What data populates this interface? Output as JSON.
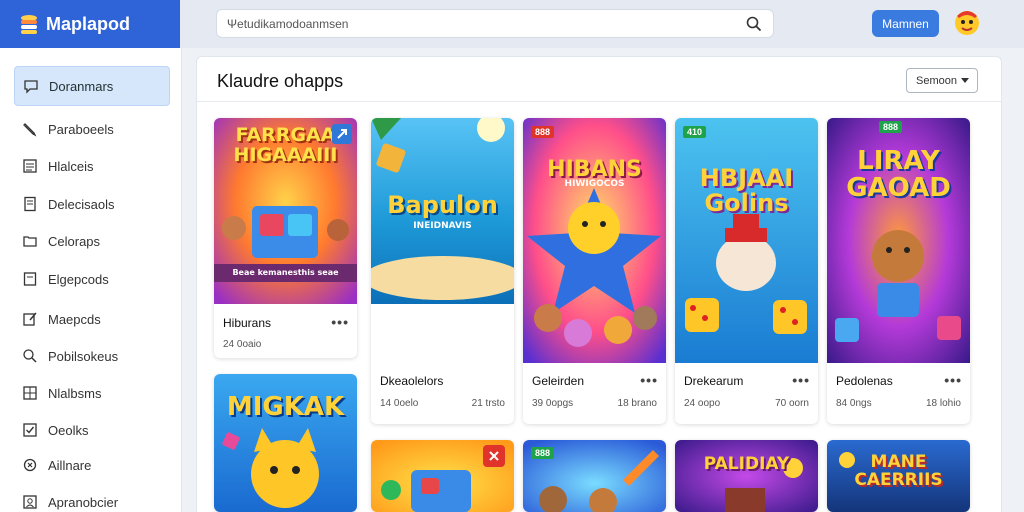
{
  "app": {
    "name": "Maplapod"
  },
  "search": {
    "placeholder": "Ψetudikamodoanmsen"
  },
  "top_button": {
    "label": "Mamnen"
  },
  "sidebar": {
    "items": [
      {
        "label": "Doranmars",
        "icon": "chat-icon"
      },
      {
        "label": "Paraboeels",
        "icon": "pencil-icon"
      },
      {
        "label": "Hlalceis",
        "icon": "list-icon"
      },
      {
        "label": "Delecisaols",
        "icon": "document-icon"
      },
      {
        "label": "Celoraps",
        "icon": "folder-icon"
      },
      {
        "label": "Elgepcods",
        "icon": "page-icon"
      },
      {
        "label": "Maepcds",
        "icon": "edit-icon"
      },
      {
        "label": "Pobilsokeus",
        "icon": "search-icon"
      },
      {
        "label": "Nlalbsms",
        "icon": "grid-icon"
      },
      {
        "label": "Oeolks",
        "icon": "checkbox-icon"
      },
      {
        "label": "Aillnare",
        "icon": "settings-icon"
      },
      {
        "label": "Apranobcier",
        "icon": "user-icon"
      }
    ]
  },
  "panel": {
    "title": "Klaudre ohapps",
    "sort_label": "Semoon"
  },
  "cards": [
    {
      "art_title": "FARRGAA\nHIGAAAIII",
      "art_sub": "Beae kemanesthis seae",
      "name": "Hiburans",
      "meta_left": "24 0oaio",
      "meta_right": "",
      "badge": "",
      "badge_color": ""
    },
    {
      "art_title": "Bapulon",
      "art_sub": "INEIDNAVIS",
      "name": "Dkeaolelors",
      "meta_left": "14 0oelo",
      "meta_right": "21 trsto",
      "badge": "",
      "badge_color": ""
    },
    {
      "art_title": "HIBANS",
      "art_sub": "HIWIGOCOS",
      "name": "Geleirden",
      "meta_left": "39 0opgs",
      "meta_right": "18 brano",
      "badge": "888",
      "badge_color": "#e0342a"
    },
    {
      "art_title": "HBJAAI\nGolins",
      "art_sub": "",
      "name": "Drekearum",
      "meta_left": "24 oopo",
      "meta_right": "70 oorn",
      "badge": "410",
      "badge_color": "#1fa34a"
    },
    {
      "art_title": "LIRAY\nGAOAD",
      "art_sub": "",
      "name": "Pedolenas",
      "meta_left": "84 0ngs",
      "meta_right": "18 lohio",
      "badge": "888",
      "badge_color": "#1fa34a"
    },
    {
      "art_title": "MIGKAK",
      "art_sub": "",
      "name": "",
      "meta_left": "",
      "meta_right": "",
      "badge": "",
      "badge_color": ""
    },
    {
      "art_title": "",
      "art_sub": "",
      "name": "",
      "meta_left": "",
      "meta_right": "",
      "badge": "",
      "badge_color": ""
    },
    {
      "art_title": "",
      "art_sub": "",
      "name": "",
      "meta_left": "",
      "meta_right": "",
      "badge": "888",
      "badge_color": "#1fa34a"
    },
    {
      "art_title": "PALIDIAY",
      "art_sub": "",
      "name": "",
      "meta_left": "",
      "meta_right": "",
      "badge": "",
      "badge_color": ""
    },
    {
      "art_title": "MANE\nCAERRIIS",
      "art_sub": "",
      "name": "",
      "meta_left": "",
      "meta_right": "",
      "badge": "",
      "badge_color": ""
    }
  ],
  "colors": {
    "brand": "#2f63d8",
    "accent": "#3a7be0",
    "active_bg": "#d6e6fb"
  }
}
